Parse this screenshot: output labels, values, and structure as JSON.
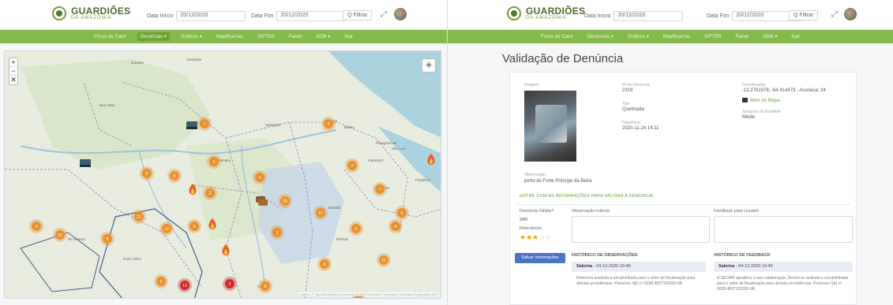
{
  "app": {
    "logo_title": "GUARDIÕES",
    "logo_sub": "DA AMAZÔNIA"
  },
  "left": {
    "header": {
      "start_label": "Data Início",
      "start_value": "20/12/2020",
      "end_label": "Data Fim",
      "end_value": "20/12/2020",
      "filter_label": "Q Filtrar"
    },
    "nav": [
      "Focos de Calor",
      "Denúncias ▾",
      "Gráficos ▾",
      "Mapificarnas",
      "SIPTER",
      "Painel",
      "ADM ▾",
      "Sair"
    ],
    "active_nav": 1,
    "map": {
      "zoom_in": "+",
      "zoom_out": "−",
      "zoom_reset": "✕",
      "layers_icon": "layers-icon",
      "attribution": "Leaflet | © OpenStreetMap contributors, © 2020 Microsoft Corporation, Earthstar Geographics SIO",
      "place_labels": [
        "Suriname",
        "Guyana",
        "Macapá",
        "Belém",
        "São Luís",
        "Teresina",
        "Fortaleza",
        "Manaus",
        "Santarém",
        "Boa Vista",
        "Porto Velho",
        "Rio Branco",
        "Cuiabá",
        "Palmas",
        "Imperatriz",
        "Paragominas",
        "Marabá"
      ],
      "clusters": [
        {
          "label": "7"
        },
        {
          "label": "3"
        },
        {
          "label": "5"
        },
        {
          "label": "4"
        },
        {
          "label": "12"
        },
        {
          "label": "8"
        },
        {
          "label": "2"
        },
        {
          "label": "21"
        },
        {
          "label": "6"
        },
        {
          "label": "15"
        },
        {
          "label": "9"
        },
        {
          "label": "3"
        },
        {
          "label": "18"
        },
        {
          "label": "10"
        },
        {
          "label": "5"
        },
        {
          "label": "7"
        },
        {
          "label": "4"
        },
        {
          "label": "11"
        },
        {
          "label": "6"
        },
        {
          "label": "3"
        },
        {
          "label": "8"
        },
        {
          "label": "2"
        },
        {
          "label": "4"
        },
        {
          "label": "9"
        },
        {
          "label": "5"
        },
        {
          "label": "12"
        },
        {
          "label": "3"
        },
        {
          "label": "6"
        }
      ],
      "accent_color": "#e8912f",
      "alert_color": "#cc2b2b"
    }
  },
  "right": {
    "header": {
      "start_label": "Data Início",
      "start_value": "20/12/2020",
      "end_label": "Data Fim",
      "end_value": "20/12/2020",
      "filter_label": "Q Filtrar"
    },
    "nav": [
      "Focos de Calor",
      "Denúncias ▾",
      "Gráficos ▾",
      "Mapificarnas",
      "SIPTER",
      "Painel",
      "ADM ▾",
      "Sair"
    ],
    "page_title": "Validação de Denúncia",
    "detail": {
      "image_label": "Imagem",
      "id_label": "ID da Denúncia",
      "id_value": "2319",
      "type_label": "Tipo",
      "type_value": "Queimada",
      "date_label": "Data/Hora",
      "date_value": "2020-11-24 14:11",
      "coords_label": "Coordenadas",
      "coords_value": "-12.2781978, -64.414473 - Acurácia: 24",
      "map_link": "Abrir no Mapa",
      "size_label": "Tamanho do Incidente",
      "size_value": "Médio",
      "obs_label": "Observação",
      "obs_value": "perto do Forte Príncipe da Beira"
    },
    "validate": {
      "section_title": "ENTRE COM AS INFORMAÇÕES PARA VALIDAR A DENÚNCIA",
      "valid_label": "Denúncia Válida?",
      "valid_value": "SIM",
      "relevance_label": "Relevância:",
      "relevance_value": 3,
      "relevance_max": 5,
      "internal_obs_label": "Observação interna",
      "feedback_label": "Feedback para Usuário",
      "save_label": "Salvar Informações"
    },
    "history_obs": {
      "title": "HISTÓRICO DE OBSERVAÇÕES",
      "author": "Sabrina",
      "date": "04-12-2020 10:49",
      "text": "Denúncia avaliada e encaminhada para o setor de fiscalização para demais providências. Processo SEI nº 0028.4837162020-98."
    },
    "history_feedback": {
      "title": "HISTÓRICO DE FEEDBACK",
      "author": "Sabrina",
      "date": "04-12-2020 10:49",
      "text": "A SEDAM agradece a sua colaboração. Denúncia avaliada e encaminhada para o setor de fiscalização para demais providências. Processo SEI nº 0028.4837162020-98."
    }
  }
}
